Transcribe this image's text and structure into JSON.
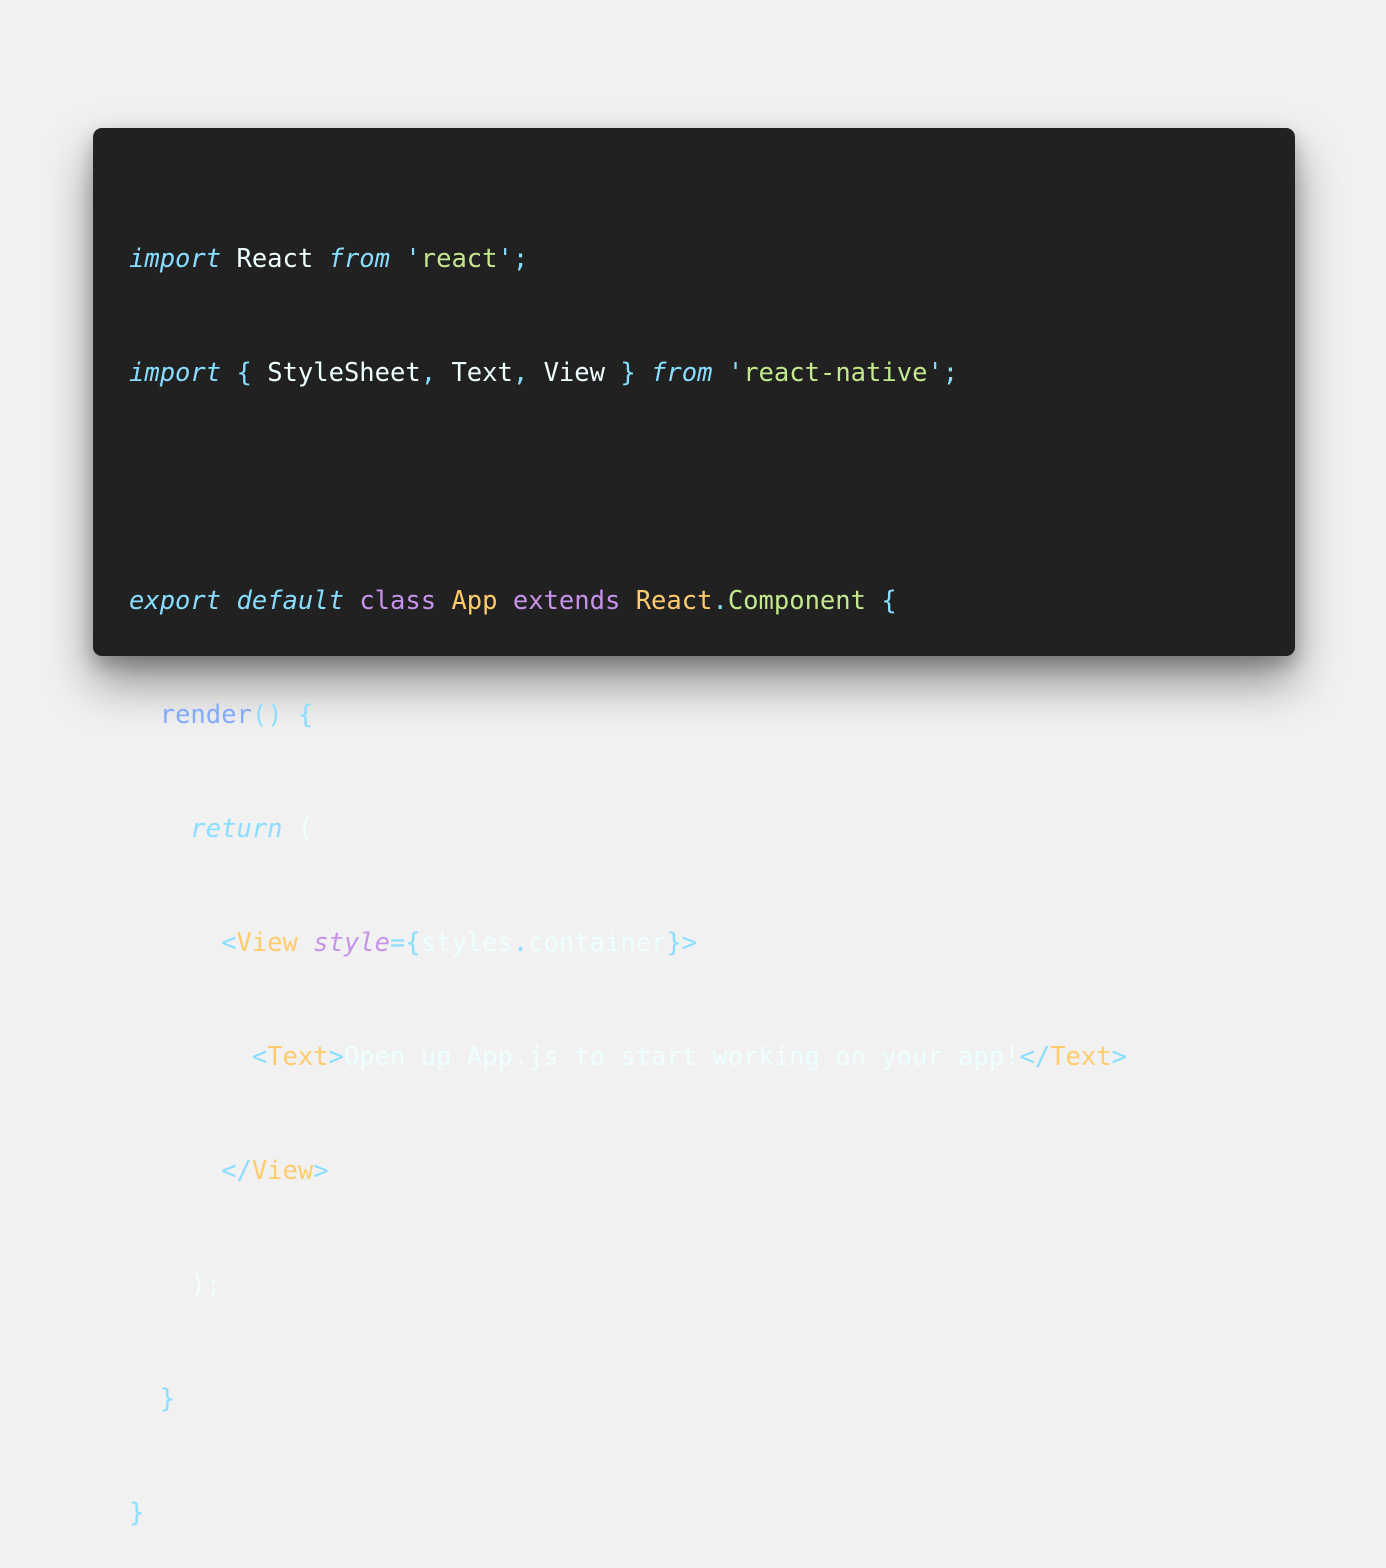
{
  "colors": {
    "page_background": "#f1f1f1",
    "editor_background": "#212121",
    "keyword": "#89ddff",
    "identifier": "#eeffff",
    "string": "#c3e88d",
    "storage": "#c792ea",
    "class_name": "#ffcb6b",
    "function": "#82aaff"
  },
  "code": {
    "line1": {
      "t0": "import",
      "t1": " React ",
      "t2": "from",
      "t3": " '",
      "t4": "react",
      "t5": "';"
    },
    "line2": {
      "t0": "import",
      "t1": " { ",
      "t2": "StyleSheet",
      "t3": ", ",
      "t4": "Text",
      "t5": ", ",
      "t6": "View",
      "t7": " } ",
      "t8": "from",
      "t9": " '",
      "t10": "react-native",
      "t11": "';"
    },
    "line3": {},
    "line4": {
      "t0": "export",
      "t1": " ",
      "t2": "default",
      "t3": " ",
      "t4": "class",
      "t5": " ",
      "t6": "App",
      "t7": " ",
      "t8": "extends",
      "t9": " ",
      "t10": "React",
      "t11": ".",
      "t12": "Component",
      "t13": " {"
    },
    "line5": {
      "t0": "  ",
      "t1": "render",
      "t2": "() {"
    },
    "line6": {
      "t0": "    ",
      "t1": "return",
      "t2": " ("
    },
    "line7": {
      "t0": "      <",
      "t1": "View",
      "t2": " ",
      "t3": "style",
      "t4": "=",
      "t5": "{",
      "t6": "styles",
      "t7": ".",
      "t8": "container",
      "t9": "}>"
    },
    "line8": {
      "t0": "        <",
      "t1": "Text",
      "t2": ">",
      "t3": "Open up App.js to start working on your app!",
      "t4": "</",
      "t5": "Text",
      "t6": ">"
    },
    "line9": {
      "t0": "      </",
      "t1": "View",
      "t2": ">"
    },
    "line10": {
      "t0": "    );"
    },
    "line11": {
      "t0": "  }"
    },
    "line12": {
      "t0": "}"
    }
  }
}
